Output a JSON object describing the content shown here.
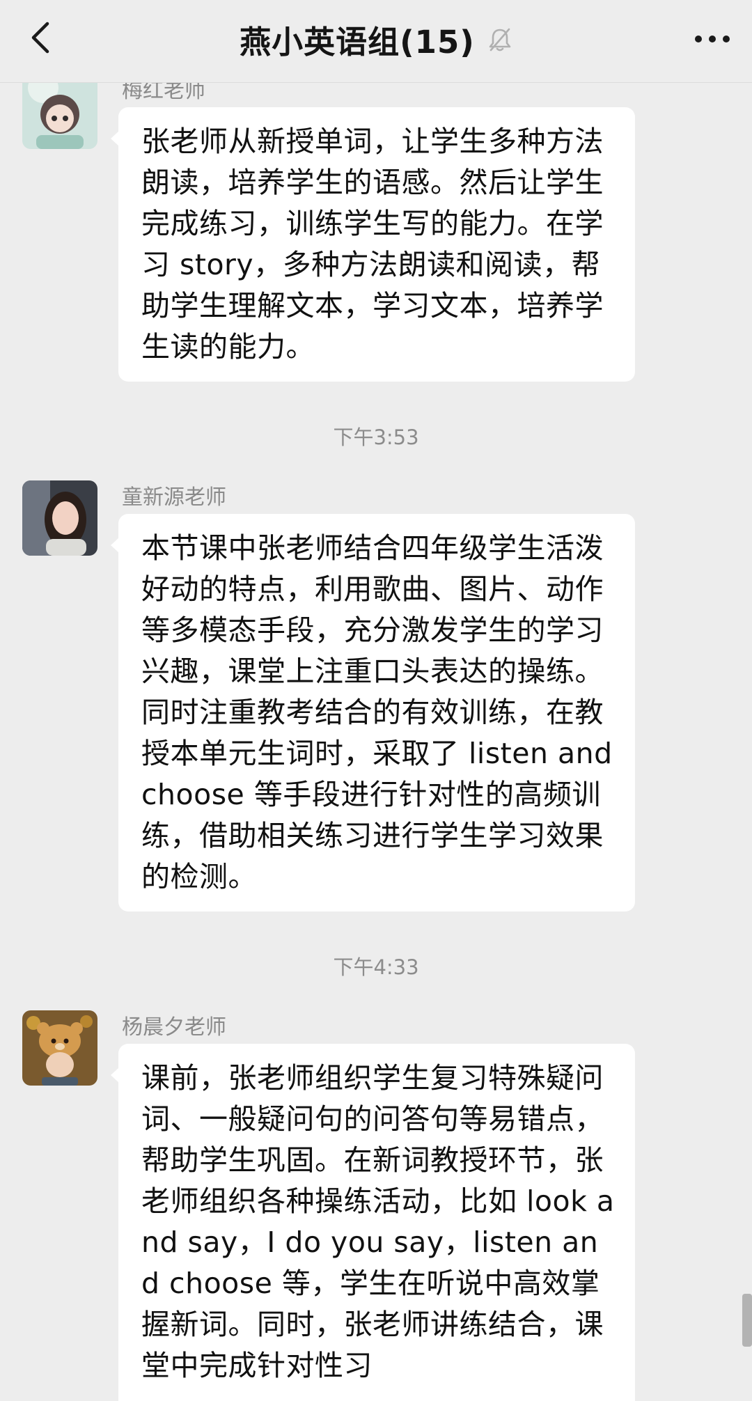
{
  "header": {
    "title": "燕小英语组(15)",
    "icons": {
      "back": "chevron-left-icon",
      "mute": "bell-off-icon",
      "more": "more-horizontal-icon"
    }
  },
  "messages": [
    {
      "sender": "梅红老师",
      "text": "张老师从新授单词，让学生多种方法朗读，培养学生的语感。然后让学生完成练习，训练学生写的能力。在学习 story，多种方法朗读和阅读，帮助学生理解文本，学习文本，培养学生读的能力。"
    },
    {
      "time": "下午3:53",
      "sender": "童新源老师",
      "text": "本节课中张老师结合四年级学生活泼好动的特点，利用歌曲、图片、动作等多模态手段，充分激发学生的学习兴趣，课堂上注重口头表达的操练。同时注重教考结合的有效训练，在教授本单元生词时，采取了 listen and choose 等手段进行针对性的高频训练，借助相关练习进行学生学习效果的检测。"
    },
    {
      "time": "下午4:33",
      "sender": "杨晨夕老师",
      "text": "课前，张老师组织学生复习特殊疑问词、一般疑问句的问答句等易错点，帮助学生巩固。在新词教授环节，张老师组织各种操练活动，比如 look and say，I do you say，listen and choose 等，学生在听说中高效掌握新词。同时，张老师讲练结合，课堂中完成针对性习"
    }
  ],
  "colors": {
    "background": "#ededed",
    "bubble": "#ffffff",
    "meta_text": "#8a8a8a"
  }
}
